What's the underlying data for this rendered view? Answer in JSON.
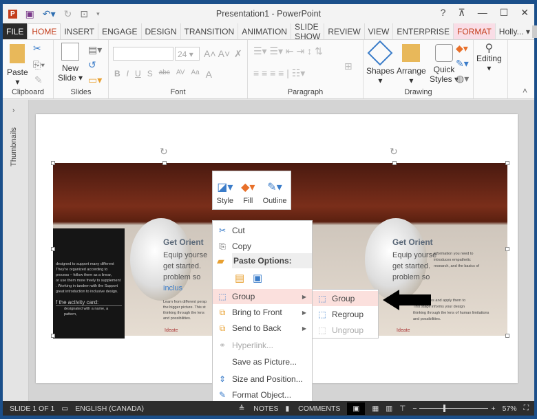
{
  "window": {
    "title": "Presentation1 - PowerPoint",
    "help": "?",
    "user": "Holly..."
  },
  "tabs": [
    "FILE",
    "HOME",
    "INSERT",
    "ENGAGE",
    "DESIGN",
    "TRANSITION",
    "ANIMATION",
    "SLIDE SHOW",
    "REVIEW",
    "VIEW",
    "ENTERPRISE",
    "FORMAT"
  ],
  "ribbon": {
    "clipboard": {
      "label": "Clipboard",
      "paste": "Paste"
    },
    "slides": {
      "label": "Slides",
      "new_slide_1": "New",
      "new_slide_2": "Slide"
    },
    "font": {
      "label": "Font",
      "size": "24",
      "bold": "B",
      "italic": "I",
      "underline": "U",
      "shadow": "S",
      "strike": "abc",
      "spacing": "AV",
      "case": "Aa",
      "color": "A"
    },
    "paragraph": {
      "label": "Paragraph"
    },
    "drawing": {
      "label": "Drawing",
      "shapes": "Shapes",
      "arrange": "Arrange",
      "quick_styles_1": "Quick",
      "quick_styles_2": "Styles"
    },
    "editing": {
      "label": "Editing"
    }
  },
  "pane": {
    "thumbnails": "Thumbnails"
  },
  "slide": {
    "heading": "Get Orient",
    "body": [
      "Equip yourse",
      "get started.",
      "problem so",
      "inclus"
    ],
    "card_text": [
      "designed to support many different",
      "They're organized according to",
      "process – follow them as a linear,",
      "or use them more freely to supplement",
      ". Working in tandem with the Support",
      "great introduction to inclusive design."
    ],
    "card_heading": "f the activity card:",
    "card_footer": "designated with a name, a pattern,",
    "right_text": [
      "information you need to",
      "introduces empathetic",
      "research, and the basics of"
    ],
    "right_text2": [
      "perspectives and apply them to",
      "This stage informs your design",
      "thinking through the lens of human limitations",
      "and possibilities."
    ],
    "left_text2": [
      "Learn from different persp",
      "the bigger picture. This st",
      "thinking through the lens",
      "and possibilities."
    ],
    "ideate": "Ideate"
  },
  "mini_toolbar": {
    "style": "Style",
    "fill": "Fill",
    "outline": "Outline"
  },
  "context_menu": {
    "cut": "Cut",
    "copy": "Copy",
    "paste_options": "Paste Options:",
    "group": "Group",
    "bring_to_front": "Bring to Front",
    "send_to_back": "Send to Back",
    "hyperlink": "Hyperlink...",
    "save_as_picture": "Save as Picture...",
    "size_position": "Size and Position...",
    "format_object": "Format Object..."
  },
  "submenu": {
    "group": "Group",
    "regroup": "Regroup",
    "ungroup": "Ungroup"
  },
  "status": {
    "slide": "SLIDE 1 OF 1",
    "language": "ENGLISH (CANADA)",
    "notes": "NOTES",
    "comments": "COMMENTS",
    "zoom": "57%"
  },
  "colors": {
    "accent": "#c43e1c",
    "format_tab": "#f9dde6",
    "highlight": "#fbe0dd"
  }
}
